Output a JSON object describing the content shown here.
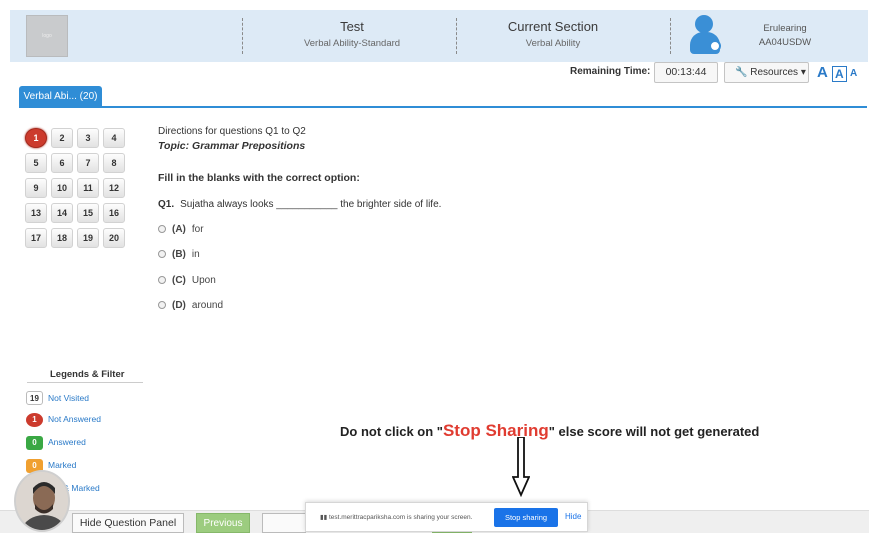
{
  "header": {
    "logo_text": "logo",
    "test_title": "Test",
    "test_subtitle": "Verbal Ability-Standard",
    "section_title": "Current Section",
    "section_subtitle": "Verbal Ability",
    "user_name": "Erulearing",
    "user_id": "AA04USDW"
  },
  "toolbar": {
    "timer_label": "Remaining Time:",
    "timer_value": "00:13:44",
    "resources_label": "Resources",
    "font_large": "A",
    "font_medium": "A",
    "font_small": "A"
  },
  "section_tab": {
    "label": "Verbal Abi... (20)"
  },
  "palette": {
    "current": 1,
    "numbers": [
      "1",
      "2",
      "3",
      "4",
      "5",
      "6",
      "7",
      "8",
      "9",
      "10",
      "11",
      "12",
      "13",
      "14",
      "15",
      "16",
      "17",
      "18",
      "19",
      "20"
    ]
  },
  "question": {
    "directions": "Directions for questions Q1 to Q2",
    "topic": "Topic: Grammar Prepositions",
    "instruction": "Fill in the blanks with the correct option:",
    "number": "Q1.",
    "text": "Sujatha always looks ___________ the brighter side of life.",
    "options": [
      {
        "key": "(A)",
        "text": "for"
      },
      {
        "key": "(B)",
        "text": "in"
      },
      {
        "key": "(C)",
        "text": "Upon"
      },
      {
        "key": "(D)",
        "text": "around"
      }
    ]
  },
  "legend": {
    "title": "Legends & Filter",
    "items": [
      {
        "count": "19",
        "label": "Not Visited",
        "color": "#ffffff"
      },
      {
        "count": "1",
        "label": "Not Answered",
        "color": "#cc3b2d"
      },
      {
        "count": "0",
        "label": "Answered",
        "color": "#3aa844"
      },
      {
        "count": "0",
        "label": "Marked",
        "color": "#f0a030"
      },
      {
        "count": "",
        "label": "ered & Marked",
        "color": "#7a56b8"
      }
    ]
  },
  "warning": {
    "prefix": "Do not click on \"",
    "highlight": "Stop Sharing",
    "suffix": "\" else score will not get generated"
  },
  "bottom": {
    "hide_panel_label": "Hide Question Panel",
    "previous_label": "Previous"
  },
  "share_bar": {
    "text": "test.merittracpariksha.com is sharing your screen.",
    "stop_label": "Stop sharing",
    "hide_label": "Hide"
  },
  "colors": {
    "accent": "#2f8dd6",
    "header_bg": "#ddeaf6",
    "current_question": "#cc3b2d",
    "warning_highlight": "#e03c31"
  }
}
